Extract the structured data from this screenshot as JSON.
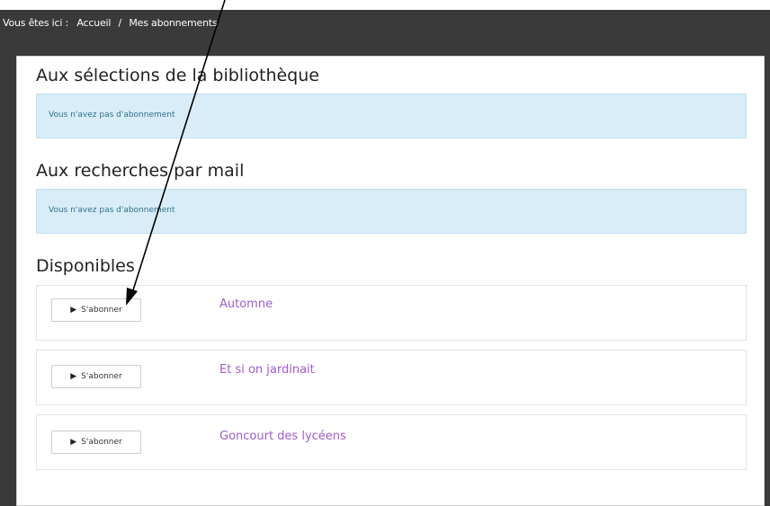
{
  "breadcrumb": {
    "prefix": "Vous êtes ici :",
    "home": "Accueil",
    "separator": "/",
    "current": "Mes abonnements"
  },
  "sections": {
    "library": {
      "title": "Aux sélections de la bibliothèque",
      "empty_message": "Vous n'avez pas d'abonnement"
    },
    "searches": {
      "title": "Aux recherches par mail",
      "empty_message": "Vous n'avez pas d'abonnement"
    },
    "available": {
      "title": "Disponibles",
      "items": [
        {
          "button_label": "S'abonner",
          "name": "Automne"
        },
        {
          "button_label": "S'abonner",
          "name": "Et si on jardinait"
        },
        {
          "button_label": "S'abonner",
          "name": "Goncourt des lycéens"
        }
      ]
    }
  },
  "icons": {
    "subscribe": "play-icon",
    "annotation": "arrow-annotation"
  },
  "colors": {
    "topbar": "#3a3a3a",
    "info_bg": "#d8edf7",
    "link": "#a15bcd"
  }
}
